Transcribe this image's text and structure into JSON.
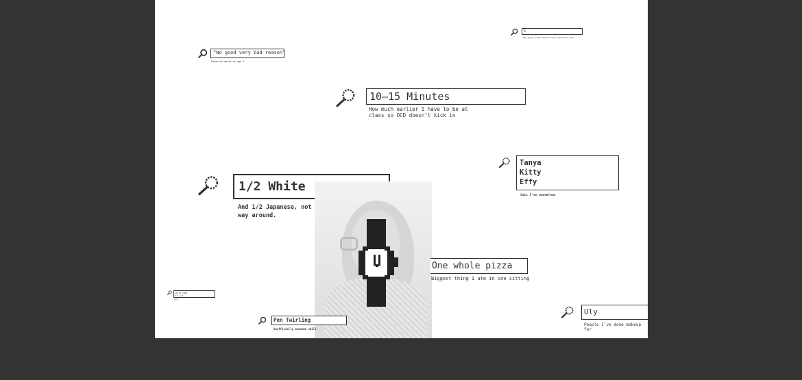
{
  "cards": {
    "quote": {
      "value": "“No good very bad reason”",
      "caption": "Favorite quote at age 7"
    },
    "celebrities": {
      "value": "5",
      "caption": "How many celebrities I have pictures with"
    },
    "minutes": {
      "value": "10–15 Minutes",
      "caption": "How much earlier I have to be at\nclass so OCD doesn’t kick in"
    },
    "cats": {
      "value": "Tanya\nKitty\nEffy",
      "caption": "Cats I’ve owned/own"
    },
    "white": {
      "value": "1/2 White",
      "caption": "And 1/2 Japanese, not the other\nway around."
    },
    "pizza": {
      "value": "One whole pizza",
      "caption": "Biggest thing I ate in one sitting"
    },
    "small": {
      "value": "10-17-1998\n5'4 1.5",
      "caption": "Tall"
    },
    "pen": {
      "value": "Pen Twirling",
      "caption": "Unofficially awesome skill"
    },
    "uly": {
      "value": "Uly",
      "caption": "People I’ve done makeup for"
    }
  },
  "icons": {
    "search": "magnifier-icon",
    "watch": "pixel-watch-icon"
  },
  "colors": {
    "background": "#333333",
    "canvas": "#ffffff",
    "ink": "#333333"
  }
}
